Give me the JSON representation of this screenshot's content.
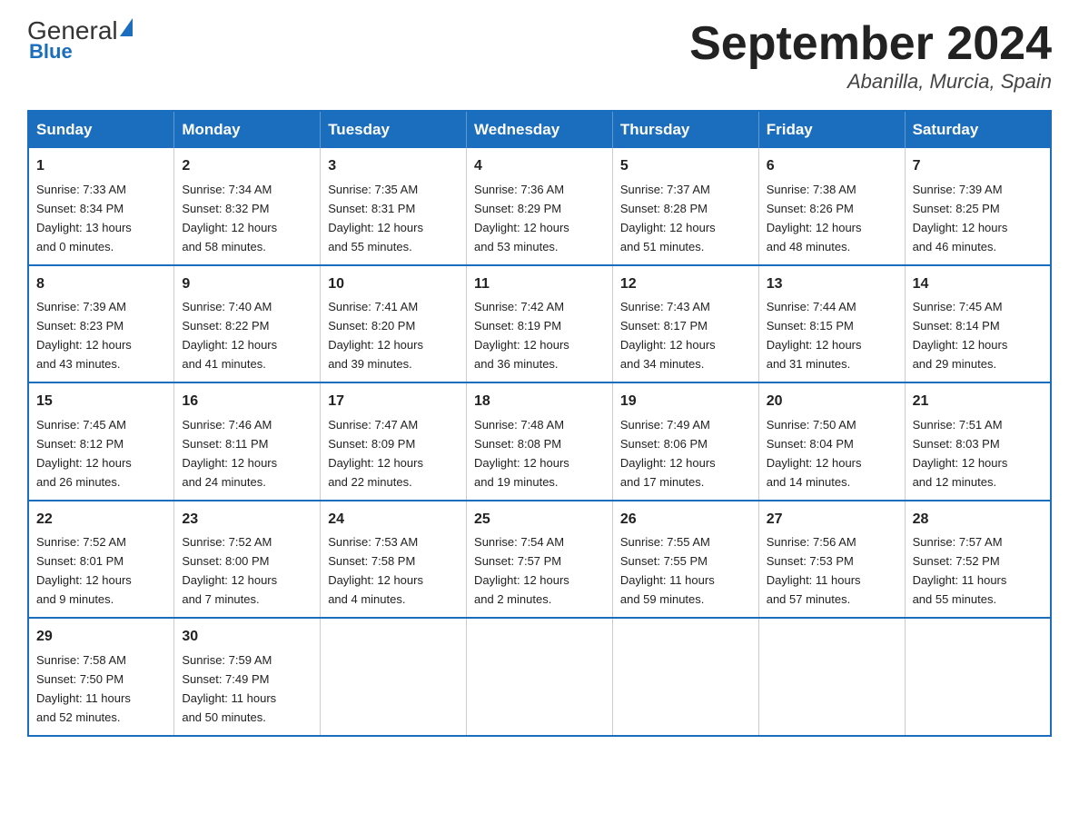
{
  "logo": {
    "text_general": "General",
    "text_blue": "Blue"
  },
  "title": "September 2024",
  "subtitle": "Abanilla, Murcia, Spain",
  "headers": [
    "Sunday",
    "Monday",
    "Tuesday",
    "Wednesday",
    "Thursday",
    "Friday",
    "Saturday"
  ],
  "weeks": [
    [
      {
        "day": "1",
        "sunrise": "7:33 AM",
        "sunset": "8:34 PM",
        "daylight": "13 hours and 0 minutes."
      },
      {
        "day": "2",
        "sunrise": "7:34 AM",
        "sunset": "8:32 PM",
        "daylight": "12 hours and 58 minutes."
      },
      {
        "day": "3",
        "sunrise": "7:35 AM",
        "sunset": "8:31 PM",
        "daylight": "12 hours and 55 minutes."
      },
      {
        "day": "4",
        "sunrise": "7:36 AM",
        "sunset": "8:29 PM",
        "daylight": "12 hours and 53 minutes."
      },
      {
        "day": "5",
        "sunrise": "7:37 AM",
        "sunset": "8:28 PM",
        "daylight": "12 hours and 51 minutes."
      },
      {
        "day": "6",
        "sunrise": "7:38 AM",
        "sunset": "8:26 PM",
        "daylight": "12 hours and 48 minutes."
      },
      {
        "day": "7",
        "sunrise": "7:39 AM",
        "sunset": "8:25 PM",
        "daylight": "12 hours and 46 minutes."
      }
    ],
    [
      {
        "day": "8",
        "sunrise": "7:39 AM",
        "sunset": "8:23 PM",
        "daylight": "12 hours and 43 minutes."
      },
      {
        "day": "9",
        "sunrise": "7:40 AM",
        "sunset": "8:22 PM",
        "daylight": "12 hours and 41 minutes."
      },
      {
        "day": "10",
        "sunrise": "7:41 AM",
        "sunset": "8:20 PM",
        "daylight": "12 hours and 39 minutes."
      },
      {
        "day": "11",
        "sunrise": "7:42 AM",
        "sunset": "8:19 PM",
        "daylight": "12 hours and 36 minutes."
      },
      {
        "day": "12",
        "sunrise": "7:43 AM",
        "sunset": "8:17 PM",
        "daylight": "12 hours and 34 minutes."
      },
      {
        "day": "13",
        "sunrise": "7:44 AM",
        "sunset": "8:15 PM",
        "daylight": "12 hours and 31 minutes."
      },
      {
        "day": "14",
        "sunrise": "7:45 AM",
        "sunset": "8:14 PM",
        "daylight": "12 hours and 29 minutes."
      }
    ],
    [
      {
        "day": "15",
        "sunrise": "7:45 AM",
        "sunset": "8:12 PM",
        "daylight": "12 hours and 26 minutes."
      },
      {
        "day": "16",
        "sunrise": "7:46 AM",
        "sunset": "8:11 PM",
        "daylight": "12 hours and 24 minutes."
      },
      {
        "day": "17",
        "sunrise": "7:47 AM",
        "sunset": "8:09 PM",
        "daylight": "12 hours and 22 minutes."
      },
      {
        "day": "18",
        "sunrise": "7:48 AM",
        "sunset": "8:08 PM",
        "daylight": "12 hours and 19 minutes."
      },
      {
        "day": "19",
        "sunrise": "7:49 AM",
        "sunset": "8:06 PM",
        "daylight": "12 hours and 17 minutes."
      },
      {
        "day": "20",
        "sunrise": "7:50 AM",
        "sunset": "8:04 PM",
        "daylight": "12 hours and 14 minutes."
      },
      {
        "day": "21",
        "sunrise": "7:51 AM",
        "sunset": "8:03 PM",
        "daylight": "12 hours and 12 minutes."
      }
    ],
    [
      {
        "day": "22",
        "sunrise": "7:52 AM",
        "sunset": "8:01 PM",
        "daylight": "12 hours and 9 minutes."
      },
      {
        "day": "23",
        "sunrise": "7:52 AM",
        "sunset": "8:00 PM",
        "daylight": "12 hours and 7 minutes."
      },
      {
        "day": "24",
        "sunrise": "7:53 AM",
        "sunset": "7:58 PM",
        "daylight": "12 hours and 4 minutes."
      },
      {
        "day": "25",
        "sunrise": "7:54 AM",
        "sunset": "7:57 PM",
        "daylight": "12 hours and 2 minutes."
      },
      {
        "day": "26",
        "sunrise": "7:55 AM",
        "sunset": "7:55 PM",
        "daylight": "11 hours and 59 minutes."
      },
      {
        "day": "27",
        "sunrise": "7:56 AM",
        "sunset": "7:53 PM",
        "daylight": "11 hours and 57 minutes."
      },
      {
        "day": "28",
        "sunrise": "7:57 AM",
        "sunset": "7:52 PM",
        "daylight": "11 hours and 55 minutes."
      }
    ],
    [
      {
        "day": "29",
        "sunrise": "7:58 AM",
        "sunset": "7:50 PM",
        "daylight": "11 hours and 52 minutes."
      },
      {
        "day": "30",
        "sunrise": "7:59 AM",
        "sunset": "7:49 PM",
        "daylight": "11 hours and 50 minutes."
      },
      null,
      null,
      null,
      null,
      null
    ]
  ],
  "labels": {
    "sunrise": "Sunrise:",
    "sunset": "Sunset:",
    "daylight": "Daylight:"
  }
}
